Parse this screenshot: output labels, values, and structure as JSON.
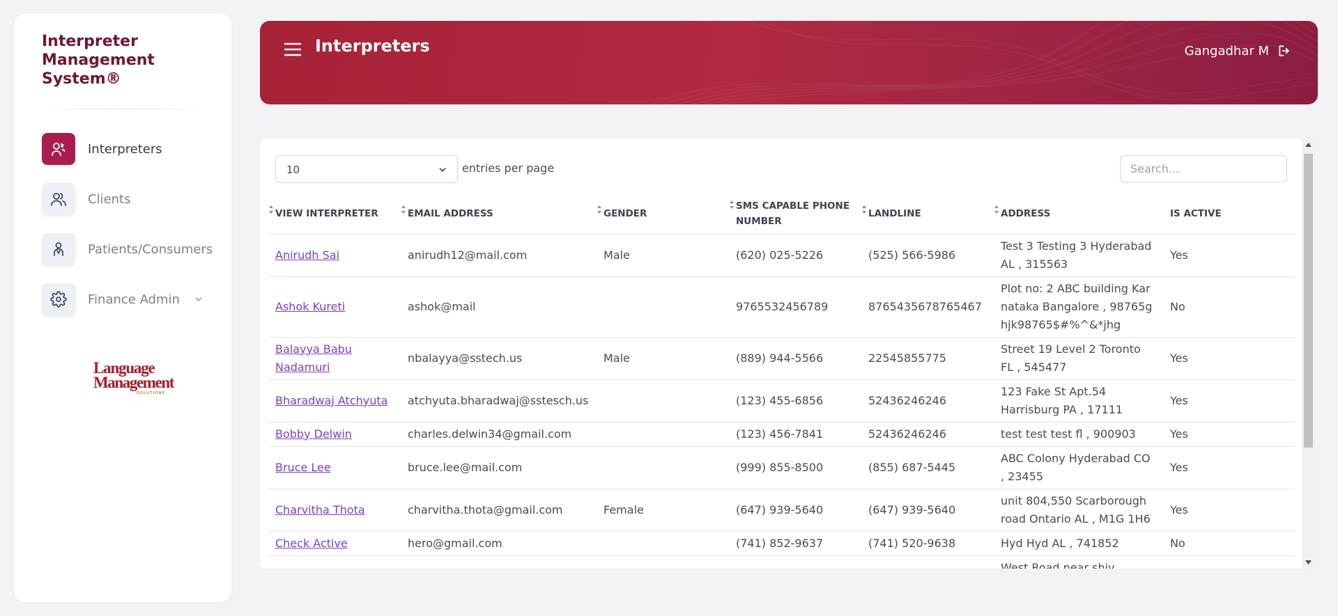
{
  "app": {
    "title": "Interpreter Management System®"
  },
  "sidebar": {
    "items": [
      {
        "label": "Interpreters",
        "icon": "interpreter-icon",
        "active": true
      },
      {
        "label": "Clients",
        "icon": "users-icon",
        "active": false
      },
      {
        "label": "Patients/Consumers",
        "icon": "person-icon",
        "active": false
      },
      {
        "label": "Finance Admin",
        "icon": "gear-icon",
        "active": false,
        "expandable": true
      }
    ],
    "logo": {
      "line1": "Language",
      "line2": "Management",
      "line3": "SOLUTIONS"
    }
  },
  "header": {
    "title": "Interpreters",
    "user_name": "Gangadhar M"
  },
  "table_controls": {
    "entries_value": "10",
    "entries_label": "entries per page",
    "search_placeholder": "Search..."
  },
  "table": {
    "columns": [
      "VIEW INTERPRETER",
      "EMAIL ADDRESS",
      "GENDER",
      "SMS CAPABLE PHONE NUMBER",
      "LANDLINE",
      "ADDRESS",
      "IS ACTIVE"
    ],
    "rows": [
      {
        "name": "Anirudh Sai",
        "email": "anirudh12@mail.com",
        "gender": "Male",
        "sms": "(620) 025-5226",
        "landline": "(525) 566-5986",
        "address": "Test 3 Testing 3 Hyderabad AL , 315563",
        "active": "Yes"
      },
      {
        "name": "Ashok Kureti",
        "email": "ashok@mail",
        "gender": "",
        "sms": "9765532456789",
        "landline": "8765435678765467",
        "address": "Plot no: 2 ABC building Karnataka Bangalore , 98765ghjk98765$#%^&*jhg",
        "active": "No"
      },
      {
        "name": "Balayya Babu Nadamuri",
        "email": "nbalayya@sstech.us",
        "gender": "Male",
        "sms": "(889) 944-5566",
        "landline": "22545855775",
        "address": "Street 19 Level 2 Toronto FL , 545477",
        "active": "Yes"
      },
      {
        "name": "Bharadwaj Atchyuta",
        "email": "atchyuta.bharadwaj@sstesch.us",
        "gender": "",
        "sms": "(123) 455-6856",
        "landline": "52436246246",
        "address": "123 Fake St Apt.54 Harrisburg PA , 17111",
        "active": "Yes"
      },
      {
        "name": "Bobby Delwin",
        "email": "charles.delwin34@gmail.com",
        "gender": "",
        "sms": "(123) 456-7841",
        "landline": "52436246246",
        "address": "test test test fl , 900903",
        "active": "Yes"
      },
      {
        "name": "Bruce Lee",
        "email": "bruce.lee@mail.com",
        "gender": "",
        "sms": "(999) 855-8500",
        "landline": "(855) 687-5445",
        "address": "ABC Colony Hyderabad CO , 23455",
        "active": "Yes"
      },
      {
        "name": "Charvitha Thota",
        "email": "charvitha.thota@gmail.com",
        "gender": "Female",
        "sms": "(647) 939-5640",
        "landline": "(647) 939-5640",
        "address": "unit 804,550 Scarborough road Ontario AL , M1G 1H6",
        "active": "Yes"
      },
      {
        "name": "Check Active",
        "email": "hero@gmail.com",
        "gender": "",
        "sms": "(741) 852-9637",
        "landline": "(741) 520-9638",
        "address": "Hyd Hyd AL , 741852",
        "active": "No"
      },
      {
        "name": "",
        "email": "",
        "gender": "",
        "sms": "",
        "landline": "",
        "address": "West Road near shiv",
        "active": ""
      }
    ]
  },
  "colors": {
    "brand": "#6e1737",
    "accent": "#a81e51",
    "header_start": "#a62236",
    "header_end": "#8a1d40",
    "link": "#7b3fc3"
  }
}
